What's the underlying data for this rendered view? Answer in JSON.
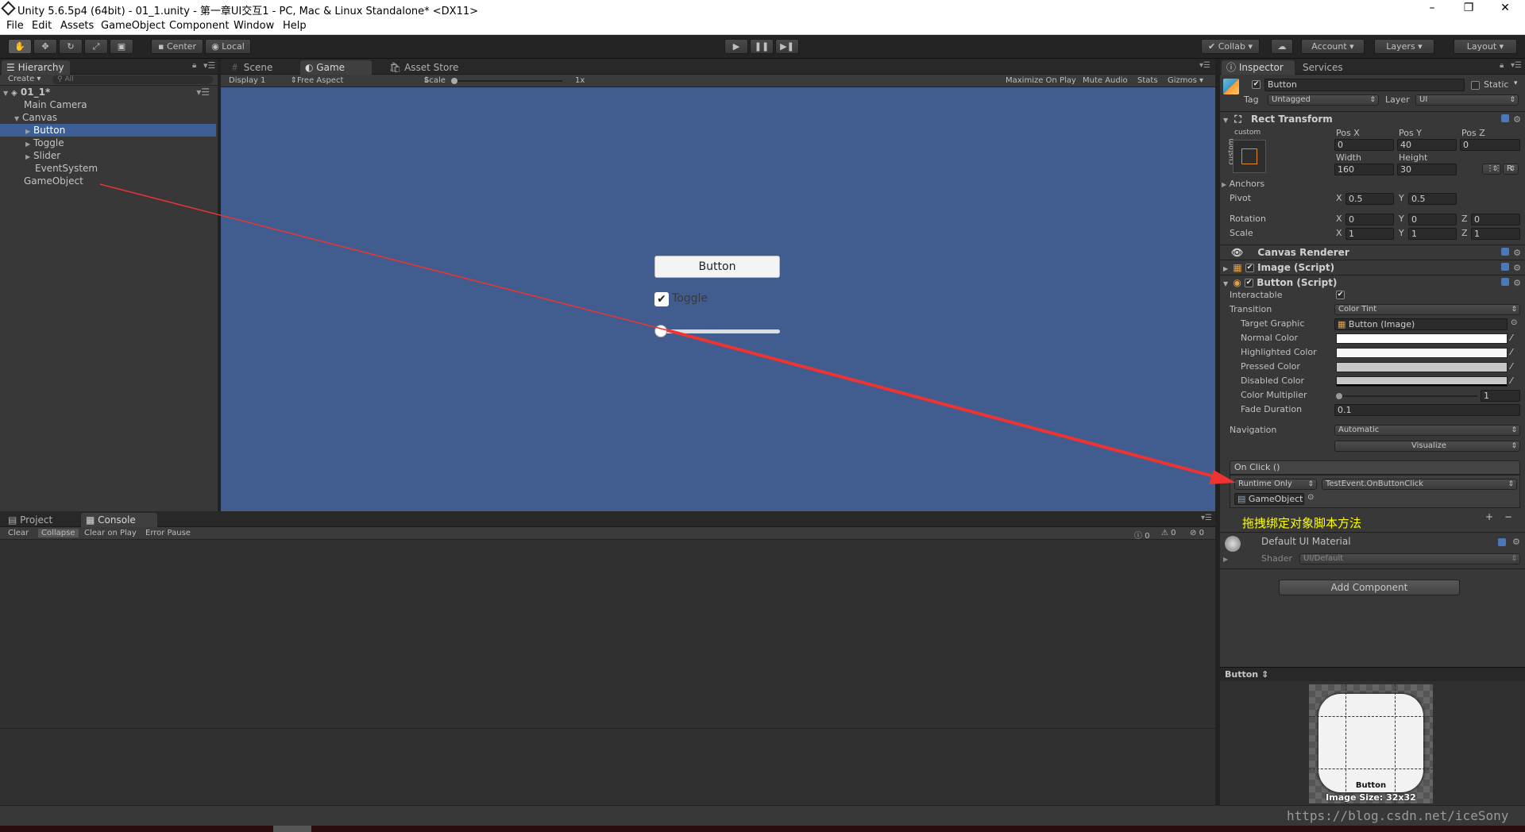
{
  "window": {
    "title": "Unity 5.6.5p4 (64bit) - 01_1.unity - 第一章UI交互1 - PC, Mac & Linux Standalone* <DX11>"
  },
  "menu": [
    "File",
    "Edit",
    "Assets",
    "GameObject",
    "Component",
    "Window",
    "Help"
  ],
  "toolbar": {
    "center": "Center",
    "local": "Local",
    "collab": "Collab",
    "account": "Account",
    "layers": "Layers",
    "layout": "Layout"
  },
  "hierarchy": {
    "tab": "Hierarchy",
    "create": "Create",
    "search_placeholder": "All",
    "scene": "01_1*",
    "items": [
      {
        "label": "Main Camera",
        "indent": 1
      },
      {
        "label": "Canvas",
        "indent": 1
      },
      {
        "label": "Button",
        "indent": 2
      },
      {
        "label": "Toggle",
        "indent": 2
      },
      {
        "label": "Slider",
        "indent": 2
      },
      {
        "label": "EventSystem",
        "indent": 2
      },
      {
        "label": "GameObject",
        "indent": 1
      }
    ]
  },
  "scene_tabs": {
    "scene": "Scene",
    "game": "Game",
    "asset_store": "Asset Store"
  },
  "game_bar": {
    "display": "Display 1",
    "aspect": "Free Aspect",
    "scale": "Scale",
    "scale_value": "1x",
    "max": "Maximize On Play",
    "mute": "Mute Audio",
    "stats": "Stats",
    "gizmos": "Gizmos"
  },
  "game_ui": {
    "button": "Button",
    "toggle": "Toggle",
    "toggle_checked": true,
    "slider_value": 0
  },
  "console": {
    "tab_project": "Project",
    "tab_console": "Console",
    "clear": "Clear",
    "collapse": "Collapse",
    "clear_on_play": "Clear on Play",
    "error_pause": "Error Pause",
    "count_log": "0",
    "count_warn": "0",
    "count_err": "0"
  },
  "inspector": {
    "tab": "Inspector",
    "services": "Services",
    "name": "Button",
    "static": "Static",
    "tag_label": "Tag",
    "tag": "Untagged",
    "layer_label": "Layer",
    "layer": "UI",
    "rect": {
      "title": "Rect Transform",
      "anchor_preset": "custom",
      "anchor_side": "custom",
      "posx_l": "Pos X",
      "posy_l": "Pos Y",
      "posz_l": "Pos Z",
      "posx": "0",
      "posy": "40",
      "posz": "0",
      "width_l": "Width",
      "height_l": "Height",
      "width": "160",
      "height": "30",
      "r": "R",
      "anchors": "Anchors",
      "pivot": "Pivot",
      "pivot_x": "0.5",
      "pivot_y": "0.5",
      "rotation": "Rotation",
      "rot_x": "0",
      "rot_y": "0",
      "rot_z": "0",
      "scale": "Scale",
      "sc_x": "1",
      "sc_y": "1",
      "sc_z": "1",
      "x": "X",
      "y": "Y",
      "z": "Z"
    },
    "canvas_renderer": "Canvas Renderer",
    "image_script": "Image (Script)",
    "button_script": "Button (Script)",
    "fields": {
      "interactable": "Interactable",
      "transition": "Transition",
      "transition_value": "Color Tint",
      "target_graphic": "Target Graphic",
      "target_graphic_value": "Button (Image)",
      "normal": "Normal Color",
      "highlighted": "Highlighted Color",
      "pressed": "Pressed Color",
      "disabled": "Disabled Color",
      "multiplier": "Color Multiplier",
      "multiplier_value": "1",
      "fade": "Fade Duration",
      "fade_value": "0.1",
      "navigation": "Navigation",
      "navigation_value": "Automatic",
      "visualize": "Visualize"
    },
    "onclick": {
      "title": "On Click ()",
      "runtime": "Runtime Only",
      "method": "TestEvent.OnButtonClick",
      "object": "GameObject",
      "plus": "+",
      "minus": "−"
    },
    "annotation": "拖拽绑定对象脚本方法",
    "material": "Default UI Material",
    "shader_label": "Shader",
    "shader": "UI/Default",
    "add_component": "Add Component",
    "preview_title": "Button",
    "preview_name": "Button",
    "preview_size": "Image Size: 32x32"
  },
  "watermark": "https://blog.csdn.net/iceSony",
  "colors": {
    "game_bg": "#415d8f",
    "selection": "#3e5f96",
    "arrow": "#ee3333",
    "annotation": "#ffff00"
  }
}
